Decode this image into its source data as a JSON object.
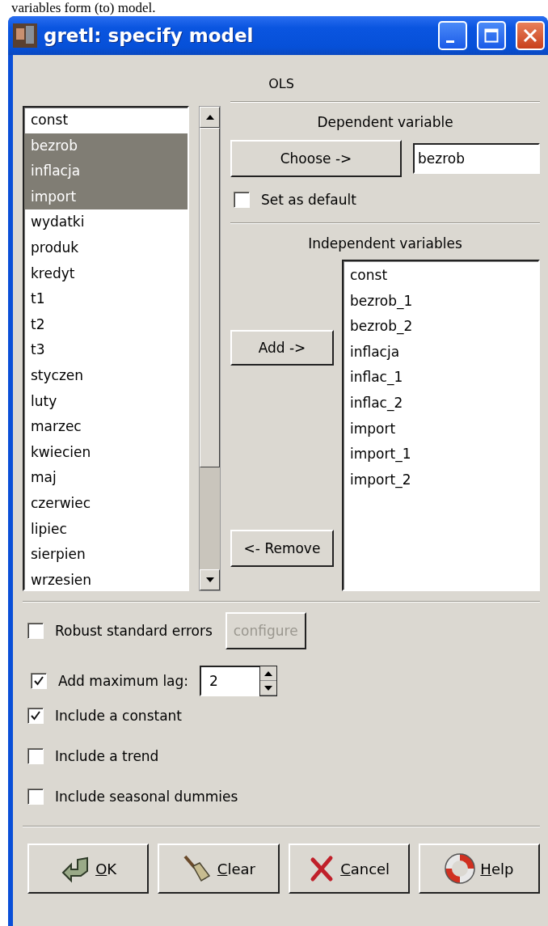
{
  "document_text": "variables form (to) model.",
  "window": {
    "title": "gretl: specify model"
  },
  "estimator": "OLS",
  "variables": [
    {
      "name": "const",
      "selected": false
    },
    {
      "name": "bezrob",
      "selected": true
    },
    {
      "name": "inflacja",
      "selected": true
    },
    {
      "name": "import",
      "selected": true
    },
    {
      "name": "wydatki",
      "selected": false
    },
    {
      "name": "produk",
      "selected": false
    },
    {
      "name": "kredyt",
      "selected": false
    },
    {
      "name": "t1",
      "selected": false
    },
    {
      "name": "t2",
      "selected": false
    },
    {
      "name": "t3",
      "selected": false
    },
    {
      "name": "styczen",
      "selected": false
    },
    {
      "name": "luty",
      "selected": false
    },
    {
      "name": "marzec",
      "selected": false
    },
    {
      "name": "kwiecien",
      "selected": false
    },
    {
      "name": "maj",
      "selected": false
    },
    {
      "name": "czerwiec",
      "selected": false
    },
    {
      "name": "lipiec",
      "selected": false
    },
    {
      "name": "sierpien",
      "selected": false
    },
    {
      "name": "wrzesien",
      "selected": false
    }
  ],
  "dependent": {
    "heading": "Dependent variable",
    "choose_button": "Choose ->",
    "value": "bezrob",
    "set_default": {
      "label": "Set as default",
      "checked": false
    }
  },
  "independent": {
    "heading": "Independent variables",
    "add_button": "Add ->",
    "remove_button": "<- Remove",
    "items": [
      "const",
      "bezrob_1",
      "bezrob_2",
      "inflacja",
      "inflac_1",
      "inflac_2",
      "import",
      "import_1",
      "import_2"
    ]
  },
  "robust": {
    "label": "Robust standard errors",
    "checked": false,
    "configure": {
      "label": "configure",
      "disabled": true
    }
  },
  "max_lag": {
    "label": "Add maximum lag:",
    "checked": true,
    "value": "2"
  },
  "options": [
    {
      "label": "Include a constant",
      "checked": true
    },
    {
      "label": "Include a trend",
      "checked": false
    },
    {
      "label": "Include seasonal dummies",
      "checked": false
    }
  ],
  "buttons": [
    {
      "kind": "ok",
      "label": "OK"
    },
    {
      "kind": "clear",
      "label": "Clear"
    },
    {
      "kind": "cancel",
      "label": "Cancel"
    },
    {
      "kind": "help",
      "label": "Help"
    }
  ]
}
